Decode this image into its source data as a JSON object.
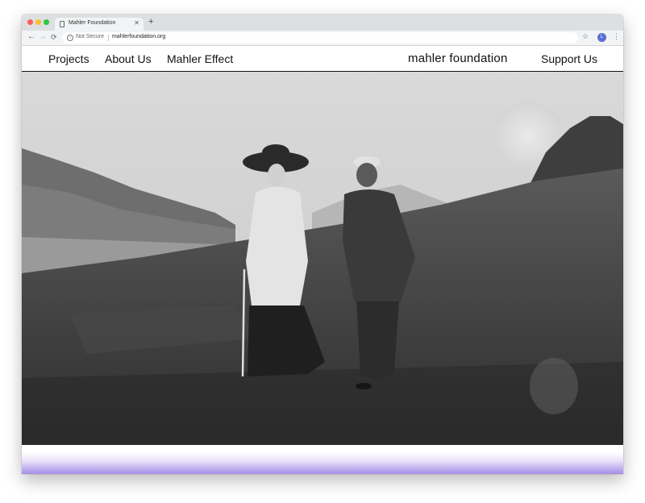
{
  "browser": {
    "tab_title": "Mahler Foundation",
    "new_tab_symbol": "+",
    "security_label": "Not Secure",
    "url": "mahlerfoundation.org",
    "profile_initial": "L",
    "icons": [
      "back-icon",
      "forward-icon",
      "reload-icon",
      "info-icon",
      "star-icon",
      "menu-icon",
      "close-icon",
      "page-icon"
    ]
  },
  "site_nav": {
    "links": [
      "Projects",
      "About Us",
      "Mahler Effect"
    ],
    "logo": "mahler foundation",
    "support_label": "Support Us"
  },
  "hero": {
    "image_description": "Vintage black-and-white photograph of a woman in a white coat and wide hat and a man in a dark suit walking on a grassy alpine hillside"
  },
  "colors": {
    "accent_gradient": "#a68ee6",
    "nav_text": "#111111"
  }
}
